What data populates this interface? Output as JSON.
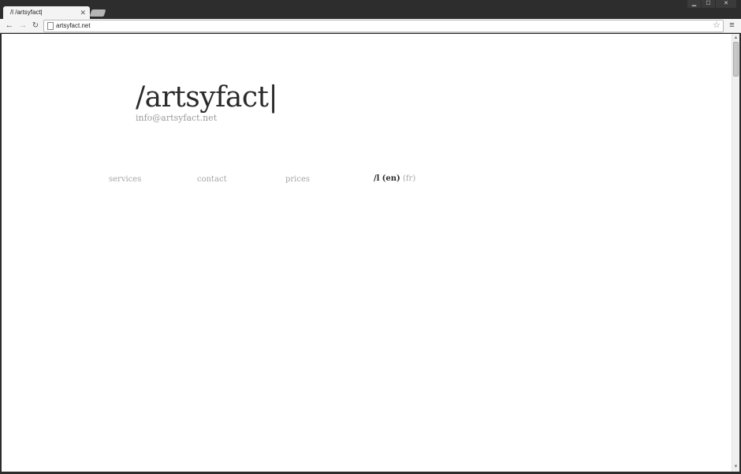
{
  "browser": {
    "tab_title": "/l  /artsyfact|",
    "url": "artsyfact.net",
    "window_controls": [
      "minimize",
      "maximize",
      "close"
    ],
    "icons": {
      "back": "arrow-left-icon",
      "forward": "arrow-right-icon",
      "reload": "reload-icon",
      "bookmark": "star-icon",
      "menu": "hamburger-menu-icon"
    }
  },
  "site": {
    "logo": "/artsyfact|",
    "email": "info@artsyfact.net",
    "nav": {
      "services": "services",
      "contact": "contact",
      "prices": "prices"
    },
    "language": {
      "marker": "/l",
      "en": "(en)",
      "fr": "(fr)",
      "selected": "en"
    }
  },
  "colors": {
    "chrome_dark": "#2d2d2d",
    "toolbar": "#f4f4f4",
    "logo": "#2a2a2a",
    "muted_text": "#a6a6a6"
  }
}
